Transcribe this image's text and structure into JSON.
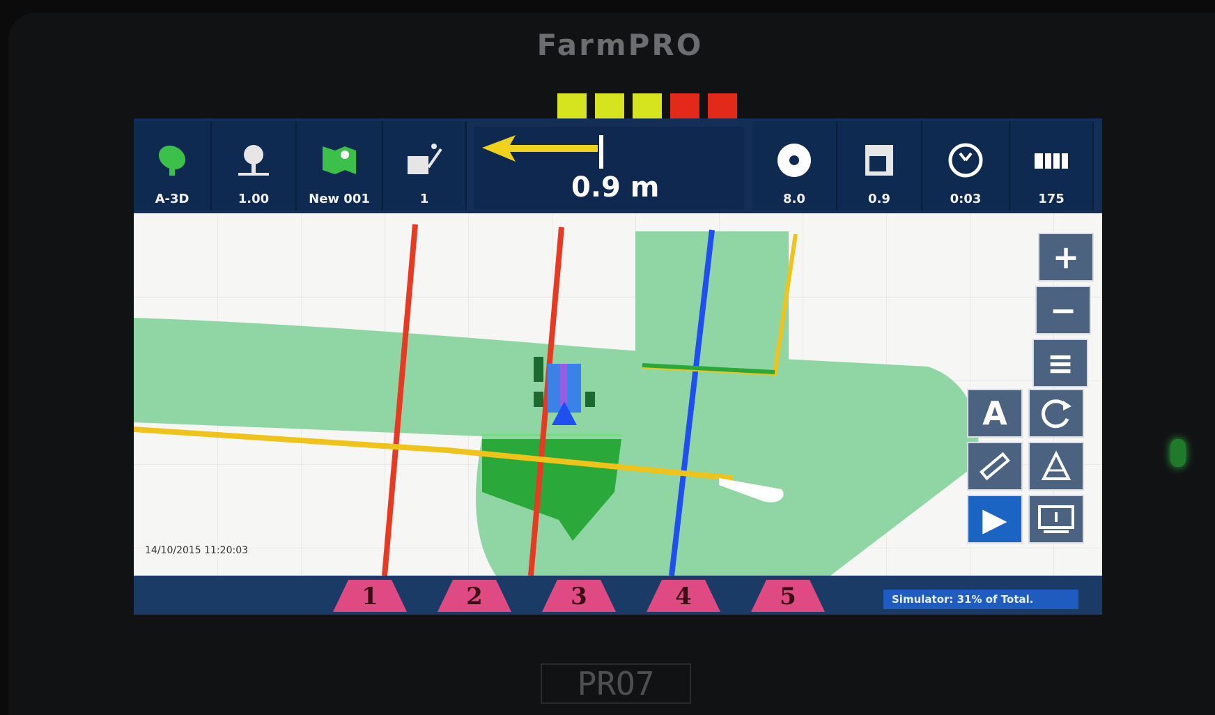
{
  "device": {
    "brand": "FarmPRO",
    "model": "PRO7"
  },
  "lightbar": {
    "squares": [
      "#d6e31f",
      "#d6e31f",
      "#d6e31f",
      "#e32a1a",
      "#e32a1a"
    ]
  },
  "topbar": {
    "gps": {
      "icon": "satellite-dish-icon",
      "value": "A-3D"
    },
    "implement_width": {
      "icon": "width-gauge-icon",
      "value": "1.00"
    },
    "field": {
      "icon": "field-map-icon",
      "value": "New 001"
    },
    "section_count": {
      "icon": "implement-sections-icon",
      "value": "1"
    },
    "crosstrack": {
      "icon": "steer-left-arrow-icon",
      "value": "0.9 m"
    },
    "speed": {
      "icon": "speedometer-icon",
      "value": "8.0"
    },
    "area": {
      "icon": "area-ha-icon",
      "value": "0.9"
    },
    "time": {
      "icon": "timer-icon",
      "value": "0:03"
    },
    "rows": {
      "icon": "row-counter-icon",
      "value": "175"
    }
  },
  "map": {
    "timestamp": "14/10/2015 11:20:03",
    "colors": {
      "coverage": "#8fd6a4",
      "guidance": "#e83a22",
      "active_line": "#1f4ff0",
      "boundary": "#f0c31a"
    }
  },
  "controls": {
    "zoom_in": "+",
    "zoom_out": "−",
    "menu": "≡",
    "auto": "A",
    "play": "▶"
  },
  "sections": [
    "1",
    "2",
    "3",
    "4",
    "5"
  ],
  "status": "Simulator: 31% of Total."
}
